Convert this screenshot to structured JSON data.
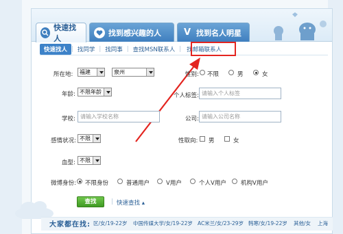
{
  "tabs": [
    {
      "label": "快速找人",
      "icon": "magnifier-icon"
    },
    {
      "label": "找到感兴趣的人",
      "icon": "heart-icon"
    },
    {
      "label": "找到名人明星",
      "icon": "v-badge-icon"
    }
  ],
  "subnav": [
    "快速找人",
    "找同学",
    "找同事",
    "查找MSN联系人",
    "找邮箱联系人"
  ],
  "form": {
    "location_label": "所在地:",
    "province": "福建",
    "city": "泉州",
    "gender_label": "性别:",
    "gender_options": [
      "不限",
      "男",
      "女"
    ],
    "gender_selected": "女",
    "age_label": "年龄:",
    "age_value": "不限年龄",
    "tag_label": "个人标签:",
    "tag_placeholder": "请输入个人标签",
    "school_label": "学校:",
    "school_placeholder": "请输入学校名称",
    "company_label": "公司:",
    "company_placeholder": "请输入公司名称",
    "relationship_label": "感情状况:",
    "relationship_value": "不限",
    "orientation_label": "性取向:",
    "orientation_options": [
      "男",
      "女"
    ],
    "blood_label": "血型:",
    "blood_value": "不限",
    "identity_label": "微博身份:",
    "identity_options": [
      "不限身份",
      "普通用户",
      "V用户",
      "个人V用户",
      "机构V用户"
    ],
    "identity_selected": "不限身份",
    "search_button": "查找",
    "quick_search": "快速查找"
  },
  "online": {
    "title": "大家都在找:",
    "items": [
      "区/女/19-22岁",
      "中国传媒大学/女/19-22岁",
      "AC米兰/女/23-29岁",
      "韩寒/女/19-22岁",
      "其他/女",
      "上海"
    ]
  },
  "colors": {
    "highlight": "#e3241f",
    "link": "#2a5f96",
    "tab_blue": "#3f7fbf",
    "search_green": "#3f9a23"
  }
}
